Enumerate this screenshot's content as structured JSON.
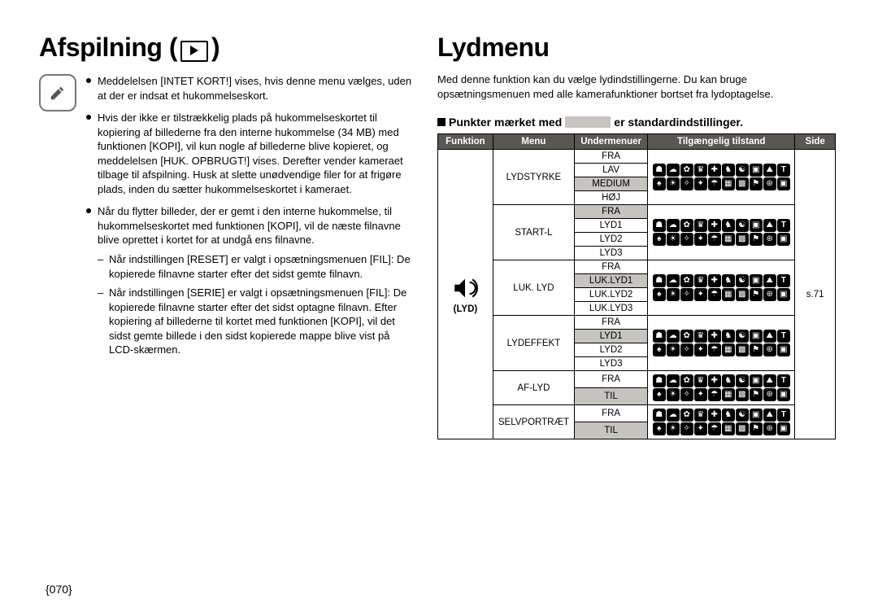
{
  "left": {
    "title": "Afspilning",
    "bullets": [
      {
        "text": "Meddelelsen [INTET KORT!] vises, hvis denne menu vælges, uden at der er indsat et hukommelseskort."
      },
      {
        "text": "Hvis der ikke er tilstrækkelig plads på hukommelseskortet til kopiering af billederne fra den interne hukommelse (34 MB) med funktionen [KOPI], vil kun nogle af billederne blive kopieret, og meddelelsen [HUK. OPBRUGT!] vises. Derefter vender kameraet tilbage til afspilning. Husk at slette unødvendige filer for at frigøre plads, inden du sætter hukommelseskortet i kameraet."
      },
      {
        "text": "Når du flytter billeder, der er gemt i den interne hukommelse, til hukommelseskortet med funktionen [KOPI], vil de næste filnavne blive oprettet i kortet for at undgå ens filnavne.",
        "subs": [
          "Når indstillingen [RESET] er valgt i opsætningsmenuen [FIL]: De kopierede filnavne starter efter det sidst gemte filnavn.",
          "Når indstillingen [SERIE] er valgt i opsætningsmenuen [FIL]: De kopierede filnavne starter efter det sidst optagne filnavn. Efter kopiering af billederne til kortet med funktionen [KOPI], vil det sidst gemte billede i den sidst kopierede mappe blive vist på LCD-skærmen."
        ]
      }
    ]
  },
  "right": {
    "title": "Lydmenu",
    "intro": "Med denne funktion kan du vælge lydindstillingerne. Du kan bruge opsætningsmenuen med alle kamerafunktioner bortset fra lydoptagelse.",
    "section": {
      "prefix": "Punkter mærket med",
      "suffix": "er standardindstillinger."
    },
    "table": {
      "headers": {
        "funktion": "Funktion",
        "menu": "Menu",
        "undermenuer": "Undermenuer",
        "tilstand": "Tilgængelig tilstand",
        "side": "Side"
      },
      "funktion": "(LYD)",
      "side": "s.71",
      "groups": [
        {
          "menu": "LYDSTYRKE",
          "subs": [
            {
              "t": "FRA",
              "d": false
            },
            {
              "t": "LAV",
              "d": false
            },
            {
              "t": "MEDIUM",
              "d": true
            },
            {
              "t": "HØJ",
              "d": false
            }
          ],
          "modeRows": 3
        },
        {
          "menu": "START-L",
          "subs": [
            {
              "t": "FRA",
              "d": true
            },
            {
              "t": "LYD1",
              "d": false
            },
            {
              "t": "LYD2",
              "d": false
            },
            {
              "t": "LYD3",
              "d": false
            }
          ],
          "modeRows": 3
        },
        {
          "menu": "LUK. LYD",
          "subs": [
            {
              "t": "FRA",
              "d": false
            },
            {
              "t": "LUK.LYD1",
              "d": true
            },
            {
              "t": "LUK.LYD2",
              "d": false
            },
            {
              "t": "LUK.LYD3",
              "d": false
            }
          ],
          "modeRows": 3
        },
        {
          "menu": "LYDEFFEKT",
          "subs": [
            {
              "t": "FRA",
              "d": false
            },
            {
              "t": "LYD1",
              "d": true
            },
            {
              "t": "LYD2",
              "d": false
            },
            {
              "t": "LYD3",
              "d": false
            }
          ],
          "modeRows": 3
        },
        {
          "menu": "AF-LYD",
          "subs": [
            {
              "t": "FRA",
              "d": false
            },
            {
              "t": "TIL",
              "d": true
            }
          ],
          "modeRows": 3
        },
        {
          "menu": "SELVPORTRÆT",
          "subs": [
            {
              "t": "FRA",
              "d": false
            },
            {
              "t": "TIL",
              "d": true
            }
          ],
          "modeRows": 3
        }
      ]
    }
  },
  "pagenum": "{070}"
}
